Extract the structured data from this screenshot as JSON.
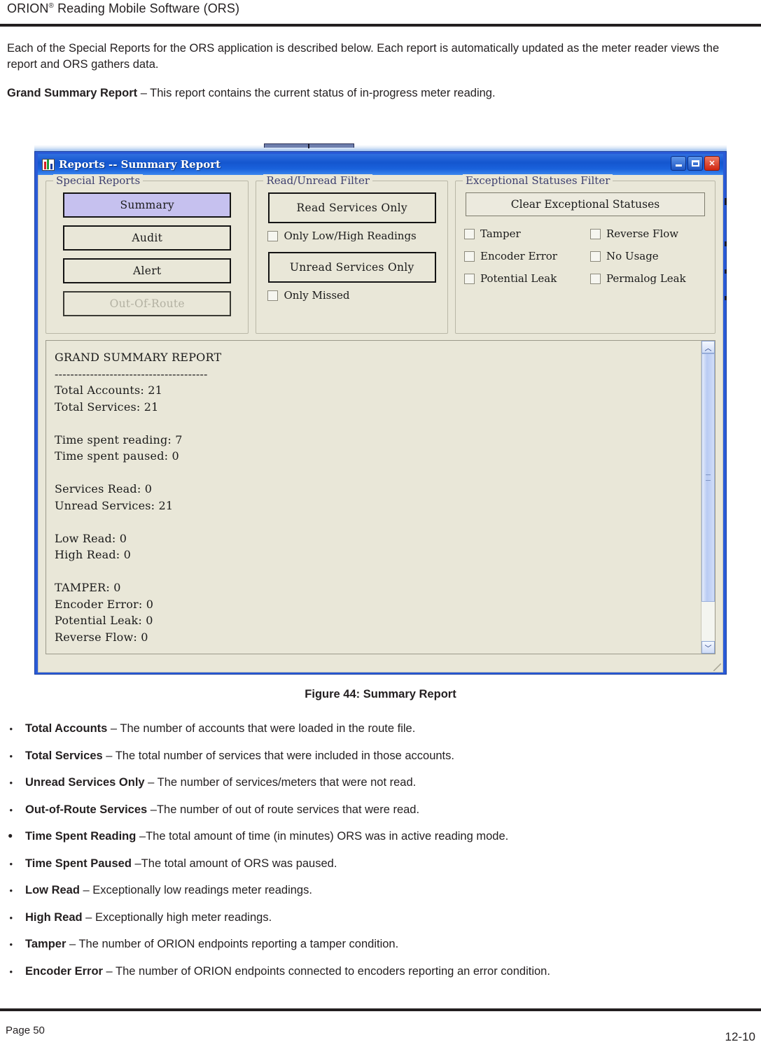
{
  "document": {
    "header_title_main": "ORION",
    "header_title_sup": "®",
    "header_title_rest": " Reading Mobile Software (ORS)",
    "intro_paragraph": "Each of the Special Reports for the ORS application is described below.  Each report is automatically updated as the meter reader views the report and ORS gathers data.",
    "grand_bold": "Grand Summary Report",
    "grand_rest": " – This report contains the current status of  in-progress meter reading.",
    "figure_caption": "Figure 44: Summary Report",
    "footer_left": "Page 50",
    "footer_right": "12-10"
  },
  "window": {
    "icon_name": "bar-chart-icon",
    "title": "Reports  -- Summary Report",
    "buttons": {
      "minimize": "_",
      "maximize": "□",
      "close": "✕"
    }
  },
  "special_reports": {
    "legend": "Special Reports",
    "buttons": [
      {
        "label": "Summary",
        "state": "selected"
      },
      {
        "label": "Audit",
        "state": "normal"
      },
      {
        "label": "Alert",
        "state": "normal"
      },
      {
        "label": "Out-Of-Route",
        "state": "disabled"
      }
    ]
  },
  "read_unread_filter": {
    "legend": "Read/Unread Filter",
    "read_button": "Read Services Only",
    "low_high_checkbox": "Only Low/High Readings",
    "unread_button": "Unread Services Only",
    "missed_checkbox": "Only Missed"
  },
  "exceptional_statuses_filter": {
    "legend": "Exceptional Statuses Filter",
    "clear_button": "Clear Exceptional Statuses",
    "checkboxes": [
      "Tamper",
      "Reverse Flow",
      "Encoder Error",
      "No Usage",
      "Potential Leak",
      "Permalog Leak"
    ]
  },
  "report_output": {
    "text": "GRAND SUMMARY REPORT\n---------------------------------------\nTotal Accounts: 21\nTotal Services: 21\n\nTime spent reading: 7\nTime spent paused: 0\n\nServices Read: 0\nUnread Services: 21\n\nLow Read: 0\nHigh Read: 0\n\nTAMPER: 0\nEncoder Error: 0\nPotential Leak: 0\nReverse Flow: 0",
    "scrollbar": {
      "up": "︿",
      "down": "﹀"
    }
  },
  "bullets": [
    {
      "term": "Total Accounts",
      "desc": " – The number of accounts that were loaded in the route file.",
      "marker": "•",
      "size": "small"
    },
    {
      "term": "Total Services",
      "desc": " – The total number of services that were included in those accounts.",
      "marker": "•",
      "size": "small"
    },
    {
      "term": "Unread Services Only",
      "desc": " – The number of services/meters that were not read.",
      "marker": "•",
      "size": "small"
    },
    {
      "term": "Out-of-Route Services",
      "desc": " –The number of out of route services that were read.",
      "marker": "•",
      "size": "small"
    },
    {
      "term": "Time Spent Reading",
      "desc": " –The total amount of time (in minutes) ORS was in active reading mode.",
      "marker": "•",
      "size": "big"
    },
    {
      "term": "Time Spent Paused",
      "desc": " –The  total  amount of ORS was paused.",
      "marker": "•",
      "size": "small"
    },
    {
      "term": "Low Read",
      "desc": " – Exceptionally low readings meter readings.",
      "marker": "•",
      "size": "small"
    },
    {
      "term": "High Read",
      "desc": " – Exceptionally high meter readings.",
      "marker": "•",
      "size": "small"
    },
    {
      "term": "Tamper",
      "desc": " – The number of ORION endpoints reporting a tamper condition.",
      "marker": "•",
      "size": "small"
    },
    {
      "term": "Encoder Error",
      "desc": " – The number of ORION endpoints connected to encoders reporting an error condition.",
      "marker": "•",
      "size": "small"
    }
  ]
}
